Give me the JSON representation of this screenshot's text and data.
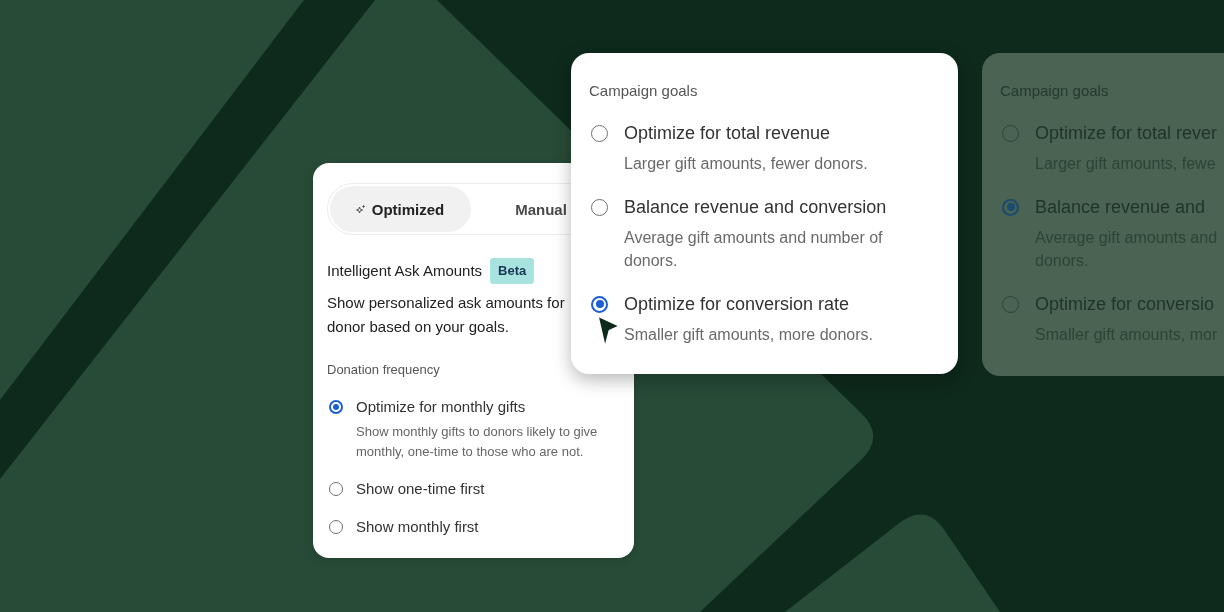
{
  "settings_card": {
    "mode_tabs": [
      {
        "label": "Optimized",
        "kind": "with_icon",
        "selected": true
      },
      {
        "label": "Manual",
        "kind": "text",
        "selected": false
      }
    ],
    "feature": {
      "title": "Intelligent Ask Amounts",
      "badge": "Beta",
      "description": "Show personalized ask amounts for donor based on your goals."
    },
    "donation_frequency": {
      "label": "Donation frequency",
      "options": [
        {
          "label": "Optimize for monthly gifts",
          "description": "Show monthly gifts to donors likely to give monthly, one-time to those who are not.",
          "selected": true
        },
        {
          "label": "Show one-time first",
          "selected": false
        },
        {
          "label": "Show monthly first",
          "selected": false
        }
      ]
    }
  },
  "goals_popup": {
    "title": "Campaign goals",
    "options": [
      {
        "label": "Optimize for total revenue",
        "description": "Larger gift amounts, fewer donors.",
        "selected": false
      },
      {
        "label": "Balance revenue and conversion",
        "description": "Average gift amounts and number of donors.",
        "selected": false
      },
      {
        "label": "Optimize for conversion rate",
        "description": "Smaller gift amounts, more donors.",
        "selected": true
      }
    ]
  },
  "goals_card": {
    "title": "Campaign goals",
    "options": [
      {
        "label": "Optimize for total rever",
        "description": "Larger gift amounts, fewe",
        "selected": false
      },
      {
        "label": "Balance revenue and",
        "description": "Average gift amounts and donors.",
        "selected": true
      },
      {
        "label": "Optimize for conversio",
        "description": "Smaller gift amounts, mor",
        "selected": false
      }
    ]
  }
}
